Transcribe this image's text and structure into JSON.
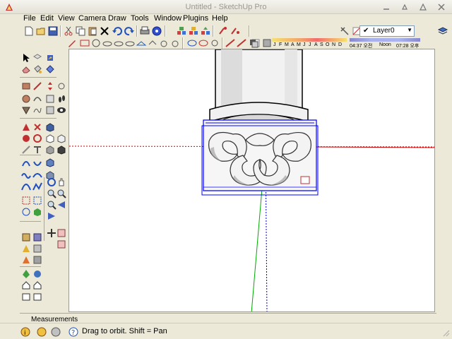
{
  "window": {
    "title": "Untitled - SketchUp Pro",
    "controls": [
      "minimize",
      "maximize",
      "close"
    ]
  },
  "menu": [
    {
      "label": "File"
    },
    {
      "label": "Edit"
    },
    {
      "label": "View"
    },
    {
      "label": "Camera"
    },
    {
      "label": "Draw"
    },
    {
      "label": "Tools"
    },
    {
      "label": "Window"
    },
    {
      "label": "Plugins"
    },
    {
      "label": "Help"
    }
  ],
  "layers": {
    "current": "Layer0",
    "checked": true
  },
  "shadow": {
    "months": [
      "J",
      "F",
      "M",
      "A",
      "M",
      "J",
      "J",
      "A",
      "S",
      "O",
      "N",
      "D"
    ],
    "start_time": "04:37 오전",
    "noon": "Noon",
    "end_time": "07:28 오후"
  },
  "measurements": {
    "label": "Measurements"
  },
  "status": {
    "hint": "Drag to orbit.  Shift = Pan"
  },
  "colors": {
    "background": "#ece9d8",
    "viewport": "#ffffff",
    "red_axis": "#cc0000",
    "green_axis": "#00aa00",
    "blue_axis": "#0000cc",
    "selection": "#0000ff",
    "model_face": "#e8e8e8"
  },
  "icons": {
    "toolbar_top": [
      "new-icon",
      "open-icon",
      "save-icon",
      "cut-icon",
      "copy-icon",
      "paste-icon",
      "erase-icon",
      "undo-icon",
      "redo-icon",
      "print-icon",
      "model-info-icon",
      "components-icon",
      "materials-icon",
      "warehouse-icon",
      "share-icon",
      "camera-icon",
      "walk-icon",
      "section-icon",
      "layer-manager-icon"
    ],
    "toolbar_draw": [
      "pencil-icon",
      "line-icon",
      "circle-icon",
      "arc-icon",
      "polygon-icon",
      "rectangle-icon",
      "push-pull-icon",
      "follow-me-icon",
      "offset-icon",
      "move-icon",
      "rotate-icon",
      "scale-icon",
      "tape-icon",
      "protractor-icon",
      "text-icon",
      "axes-icon",
      "dimension-icon",
      "paint-icon",
      "shadow-toggle-icon"
    ]
  }
}
